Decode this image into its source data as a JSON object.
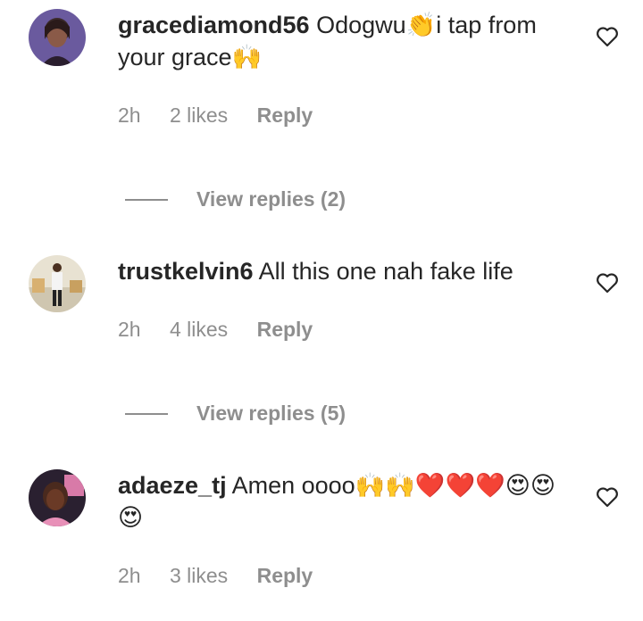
{
  "comments": [
    {
      "username": "gracediamond56",
      "text": "Odogwu👏i tap from your grace🙌",
      "time": "2h",
      "likes": "2 likes",
      "reply_label": "Reply",
      "view_replies": "View replies (2)"
    },
    {
      "username": "trustkelvin6",
      "text": "All this one nah fake life",
      "time": "2h",
      "likes": "4 likes",
      "reply_label": "Reply",
      "view_replies": "View replies (5)"
    },
    {
      "username": "adaeze_tj",
      "text": "Amen oooo🙌🙌❤️❤️❤️😍😍😍",
      "time": "2h",
      "likes": "3 likes",
      "reply_label": "Reply"
    }
  ],
  "icons": {
    "like": "heart-outline-icon"
  },
  "colors": {
    "text": "#262626",
    "secondary": "#8e8e8e"
  }
}
